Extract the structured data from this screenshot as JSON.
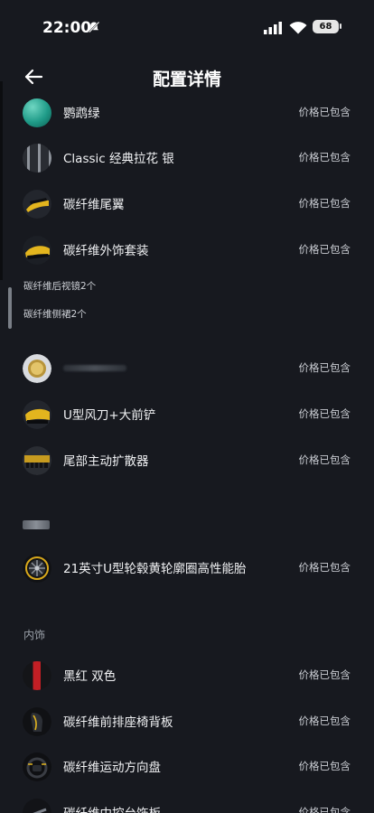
{
  "status": {
    "time": "22:00",
    "battery": "68"
  },
  "header": {
    "title": "配置详情"
  },
  "items": [
    {
      "name": "鹦鹉绿",
      "price": "价格已包含",
      "icon": "green-paint-swatch"
    },
    {
      "name": "Classic 经典拉花 银",
      "price": "价格已包含",
      "icon": "silver-stripe-swatch"
    },
    {
      "name": "碳纤维尾翼",
      "price": "价格已包含",
      "icon": "rear-wing-thumb"
    },
    {
      "name": "碳纤维外饰套装",
      "price": "价格已包含",
      "icon": "exterior-kit-thumb"
    },
    {
      "name": "",
      "price": "价格已包含",
      "icon": "badge-thumb"
    },
    {
      "name": "U型风刀+大前铲",
      "price": "价格已包含",
      "icon": "front-splitter-thumb"
    },
    {
      "name": "尾部主动扩散器",
      "price": "价格已包含",
      "icon": "diffuser-thumb"
    },
    {
      "name": "21英寸U型轮毂黄轮廓圈高性能胎",
      "price": "价格已包含",
      "icon": "wheel-thumb"
    },
    {
      "name": "黑红 双色",
      "price": "价格已包含",
      "icon": "black-red-swatch"
    },
    {
      "name": "碳纤维前排座椅背板",
      "price": "价格已包含",
      "icon": "seat-back-thumb"
    },
    {
      "name": "碳纤维运动方向盘",
      "price": "价格已包含",
      "icon": "steering-wheel-thumb"
    },
    {
      "name": "碳纤维中控台饰板",
      "price": "价格已包含",
      "icon": "console-trim-thumb"
    }
  ],
  "kit_details": [
    "碳纤维后视镜2个",
    "碳纤维侧裙2个"
  ],
  "sections": {
    "interior": "内饰"
  }
}
